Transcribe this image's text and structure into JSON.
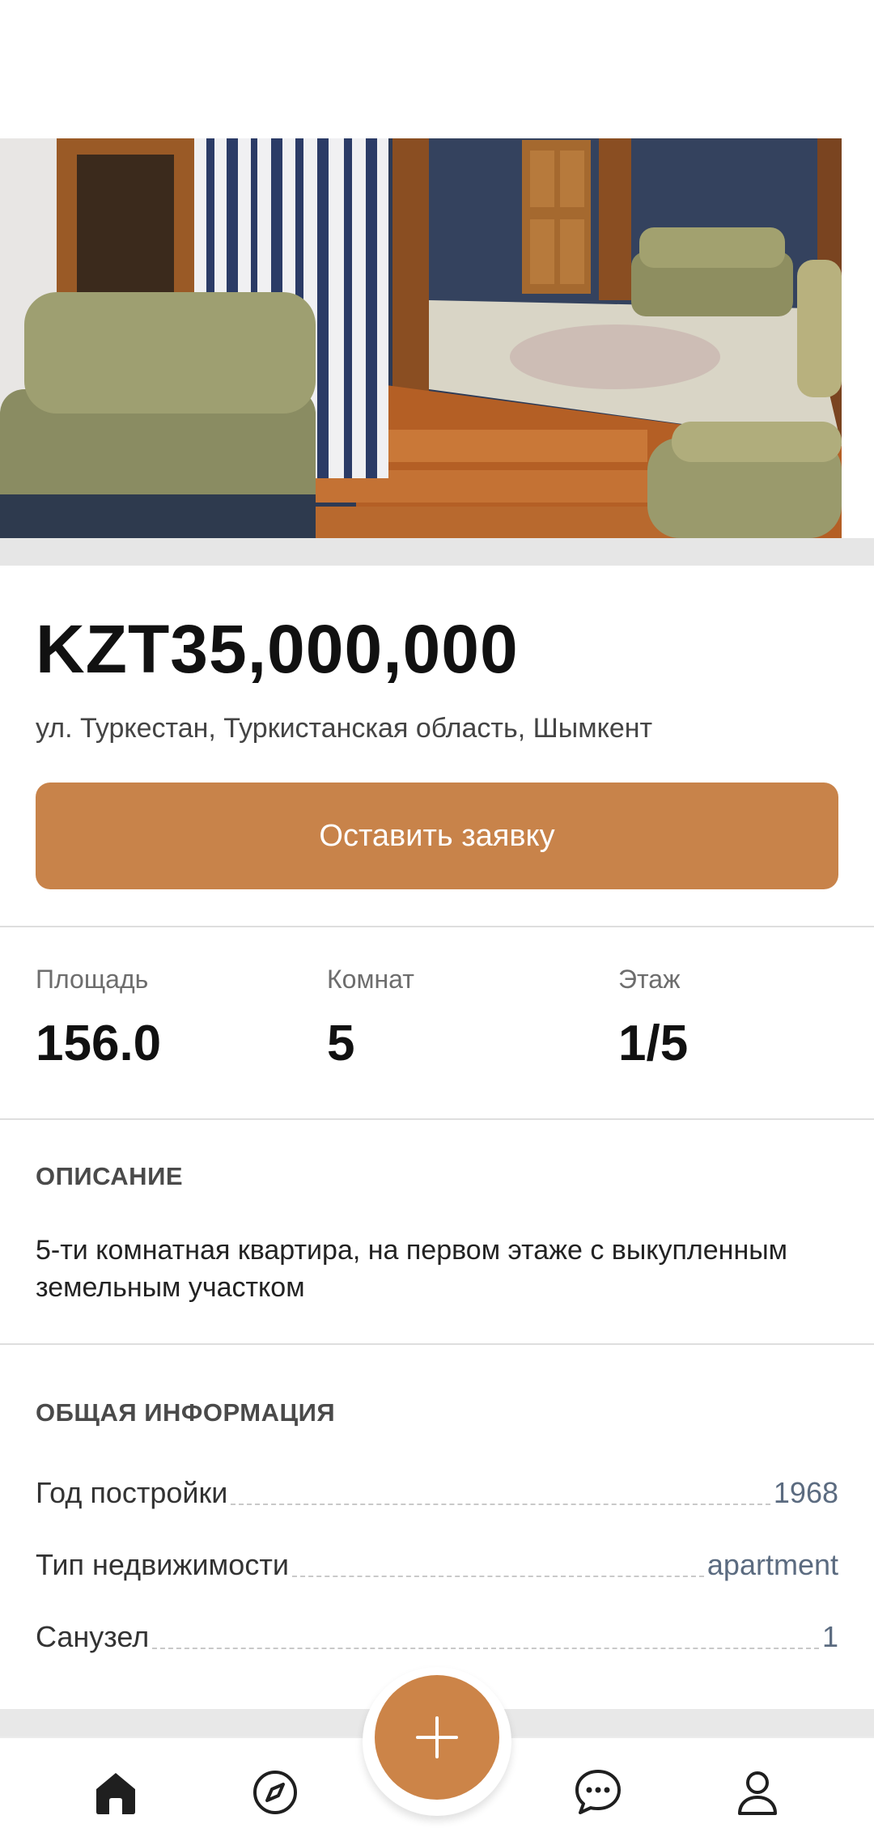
{
  "listing": {
    "price": "KZT35,000,000",
    "address": "ул. Туркестан, Туркистанская область, Шымкент",
    "apply_button": "Оставить заявку"
  },
  "stats": [
    {
      "label": "Площадь",
      "value": "156.0"
    },
    {
      "label": "Комнат",
      "value": "5"
    },
    {
      "label": "Этаж",
      "value": "1/5"
    }
  ],
  "description": {
    "title": "ОПИСАНИЕ",
    "text": "5-ти комнатная квартира, на первом этаже с выкупленным земельным участком"
  },
  "general_info": {
    "title": "ОБЩАЯ ИНФОРМАЦИЯ",
    "rows": [
      {
        "key": "Год постройки",
        "value": "1968"
      },
      {
        "key": "Тип недвижимости",
        "value": "apartment"
      },
      {
        "key": "Санузел",
        "value": "1"
      }
    ]
  },
  "tabbar": {
    "items": [
      "home-icon",
      "compass-icon",
      "add-icon",
      "chat-icon",
      "profile-icon"
    ],
    "accent": "#cc8448"
  },
  "colors": {
    "accent": "#c8834a",
    "value_text": "#5b6b80"
  }
}
